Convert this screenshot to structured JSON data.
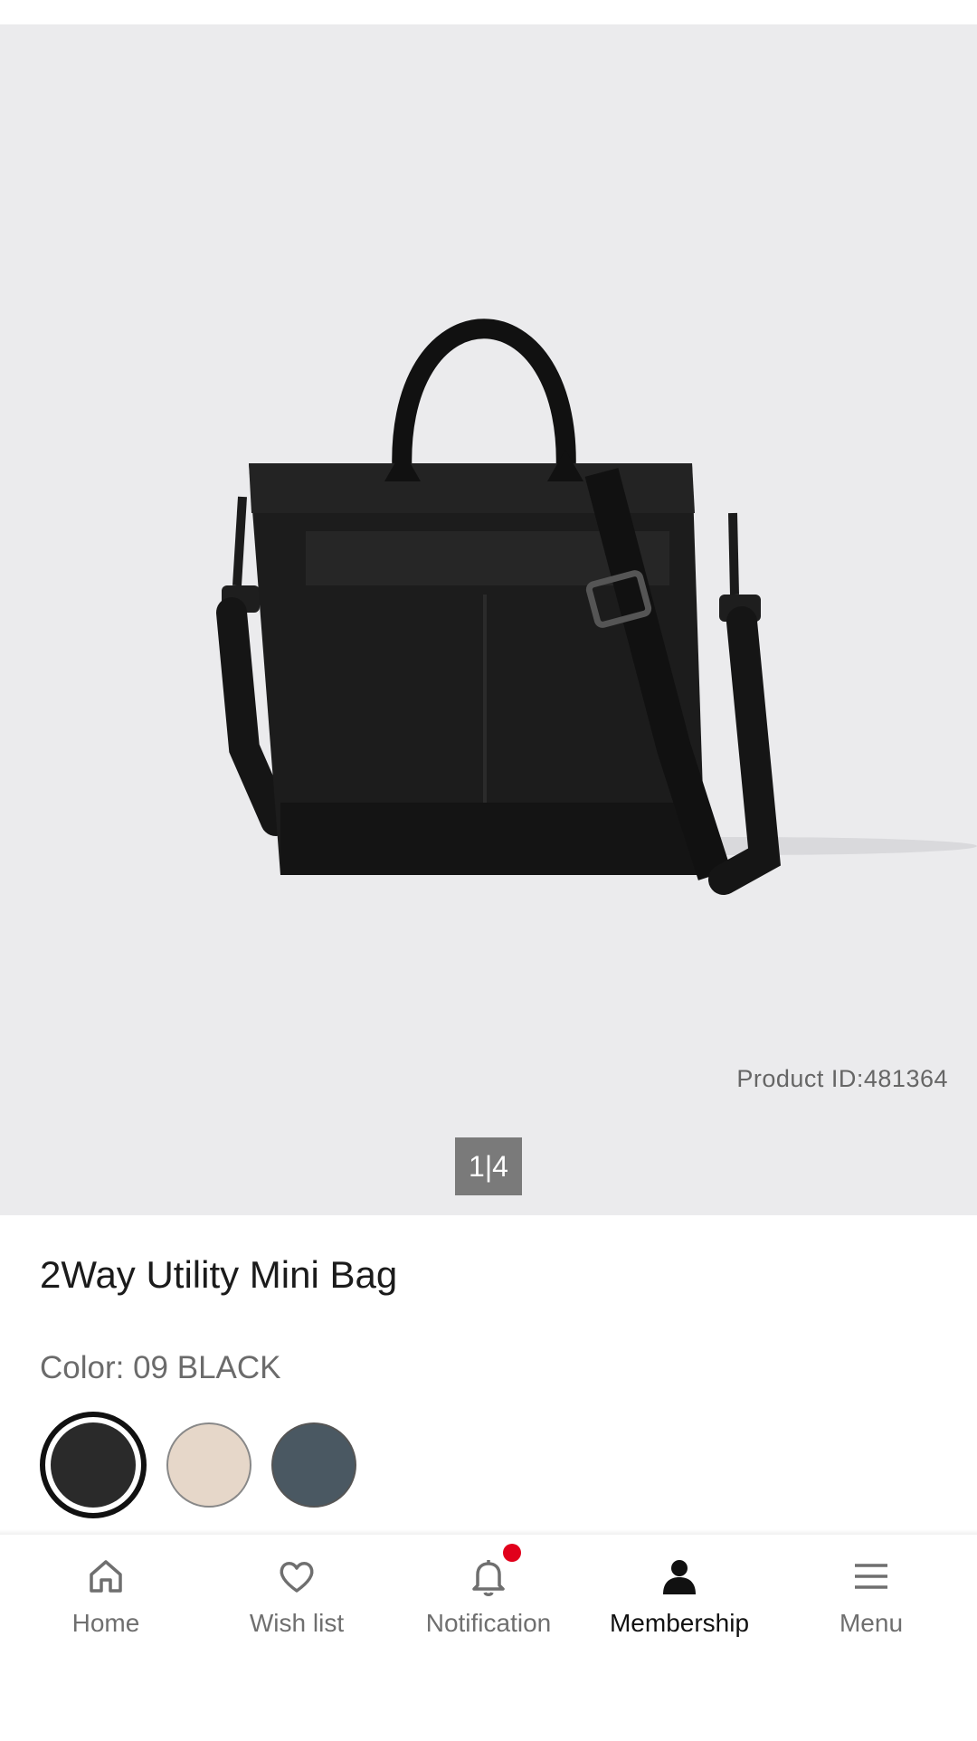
{
  "product": {
    "id_text": "Product ID:481364",
    "pager": "1|4",
    "title": "2Way Utility Mini Bag",
    "color_label": "Color: 09 BLACK",
    "swatches": [
      {
        "name": "black",
        "color": "#2a2a2a",
        "selected": true
      },
      {
        "name": "beige",
        "color": "#e6d7c9",
        "selected": false
      },
      {
        "name": "slate",
        "color": "#4a5862",
        "selected": false
      }
    ]
  },
  "bottom_nav": {
    "items": [
      {
        "label": "Home",
        "icon": "home-icon"
      },
      {
        "label": "Wish list",
        "icon": "heart-icon"
      },
      {
        "label": "Notification",
        "icon": "bell-icon",
        "badge": true
      },
      {
        "label": "Membership",
        "icon": "person-icon",
        "active": true
      },
      {
        "label": "Menu",
        "icon": "hamburger-icon"
      }
    ]
  },
  "colors": {
    "hero_bg": "#ebebed",
    "badge_red": "#e1001b"
  }
}
